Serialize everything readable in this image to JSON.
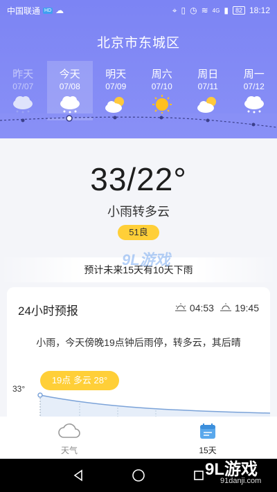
{
  "status": {
    "carrier": "中国联通",
    "carrier_badge": "HD",
    "net": "4G",
    "battery": "82",
    "time": "18:12"
  },
  "location": {
    "city": "北京市东城区"
  },
  "forecast_days": [
    {
      "name": "昨天",
      "date": "07/07",
      "icon": "rain-cloud-icon"
    },
    {
      "name": "今天",
      "date": "07/08",
      "icon": "rain-cloud-icon"
    },
    {
      "name": "明天",
      "date": "07/09",
      "icon": "partly-cloudy-icon"
    },
    {
      "name": "周六",
      "date": "07/10",
      "icon": "sun-icon"
    },
    {
      "name": "周日",
      "date": "07/11",
      "icon": "partly-cloudy-icon"
    },
    {
      "name": "周一",
      "date": "07/12",
      "icon": "rain-cloud-icon"
    }
  ],
  "current": {
    "temp": "33/22°",
    "desc": "小雨转多云",
    "aqi": "51良"
  },
  "notice": "预计未来15天有10天下雨",
  "watermark_mid": "9L游戏",
  "hourly": {
    "title": "24小时预报",
    "sunrise": "04:53",
    "sunset": "19:45",
    "desc": "小雨，今天傍晚19点钟后雨停，转多云，其后晴",
    "temp_label": "33°",
    "bubble": "19点 多云 28°"
  },
  "tabs": [
    {
      "label": "天气",
      "icon": "cloud-icon"
    },
    {
      "label": "15天",
      "icon": "calendar-icon"
    }
  ],
  "watermark": {
    "logo": "9L游戏",
    "site": "91danji.com"
  },
  "colors": {
    "header": "#7c84f4",
    "accent": "#ffcf38"
  }
}
